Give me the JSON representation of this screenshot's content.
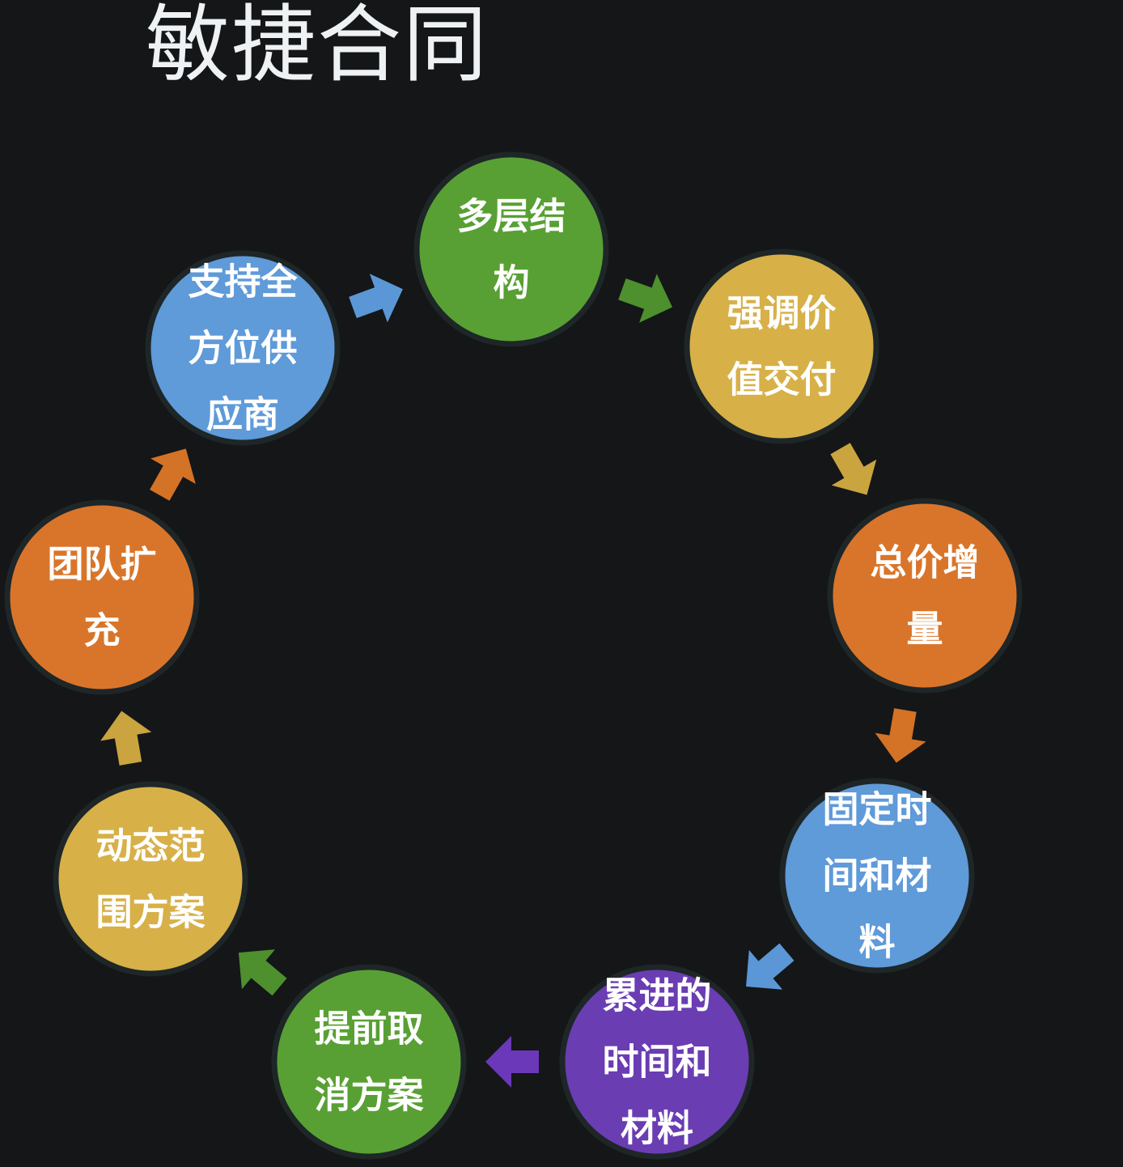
{
  "title": "敏捷合同",
  "nodes": [
    {
      "label": [
        "多层结",
        "构"
      ],
      "color": "#58a034"
    },
    {
      "label": [
        "强调价",
        "值交付"
      ],
      "color": "#d7b048"
    },
    {
      "label": [
        "总价增",
        "量"
      ],
      "color": "#d9752a"
    },
    {
      "label": [
        "固定时",
        "间和材",
        "料"
      ],
      "color": "#5f9ad9"
    },
    {
      "label": [
        "累进的",
        "时间和",
        "材料"
      ],
      "color": "#6a3db3"
    },
    {
      "label": [
        "提前取",
        "消方案"
      ],
      "color": "#58a034"
    },
    {
      "label": [
        "动态范",
        "围方案"
      ],
      "color": "#d7b048"
    },
    {
      "label": [
        "团队扩",
        "充"
      ],
      "color": "#d9752a"
    },
    {
      "label": [
        "支持全",
        "方位供",
        "应商"
      ],
      "color": "#5f9ad9"
    }
  ],
  "arrows": [
    {
      "color": "#4e8f2e"
    },
    {
      "color": "#c9a43f"
    },
    {
      "color": "#d47226"
    },
    {
      "color": "#5b97d6"
    },
    {
      "color": "#6a38b8"
    },
    {
      "color": "#4e8f2e"
    },
    {
      "color": "#c9a43f"
    },
    {
      "color": "#d47226"
    },
    {
      "color": "#5b97d6"
    }
  ]
}
